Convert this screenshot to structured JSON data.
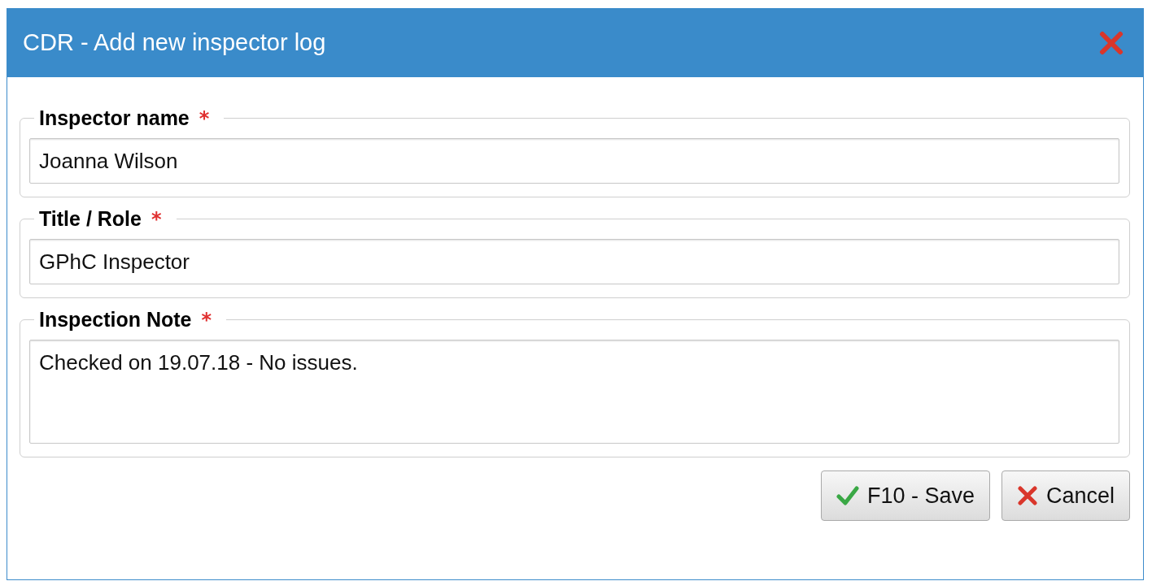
{
  "window": {
    "title": "CDR - Add new inspector log"
  },
  "fields": [
    {
      "kind": "input",
      "label": "Inspector name",
      "required_mark": "*",
      "value": "Joanna Wilson"
    },
    {
      "kind": "input",
      "label": "Title / Role",
      "required_mark": "*",
      "value": "GPhC Inspector"
    },
    {
      "kind": "textarea",
      "label": "Inspection Note",
      "required_mark": "*",
      "value": "Checked on 19.07.18 - No issues."
    }
  ],
  "buttons": [
    {
      "kind": "save",
      "label": "F10 - Save"
    },
    {
      "kind": "cancel",
      "label": "Cancel"
    }
  ]
}
